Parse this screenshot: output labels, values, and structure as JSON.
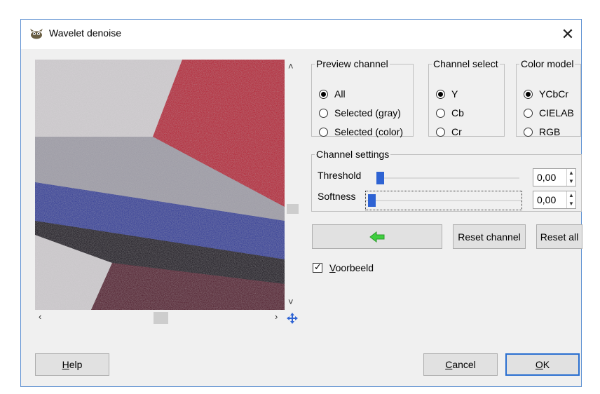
{
  "window": {
    "title": "Wavelet denoise",
    "close_label": "✕"
  },
  "preview_channel": {
    "legend": "Preview channel",
    "options": [
      {
        "label": "All",
        "selected": true
      },
      {
        "label": "Selected (gray)",
        "selected": false
      },
      {
        "label": "Selected (color)",
        "selected": false
      }
    ]
  },
  "channel_select": {
    "legend": "Channel select",
    "options": [
      {
        "label": "Y",
        "selected": true
      },
      {
        "label": "Cb",
        "selected": false
      },
      {
        "label": "Cr",
        "selected": false
      }
    ]
  },
  "color_model": {
    "legend": "Color model",
    "options": [
      {
        "label": "YCbCr",
        "selected": true
      },
      {
        "label": "CIELAB",
        "selected": false
      },
      {
        "label": "RGB",
        "selected": false
      }
    ]
  },
  "channel_settings": {
    "legend": "Channel settings",
    "threshold": {
      "label": "Threshold",
      "value": "0,00",
      "level": 0.0
    },
    "softness": {
      "label": "Softness",
      "value": "0,00",
      "level": 0.0
    }
  },
  "buttons": {
    "reset_channel": "Reset channel",
    "reset_all": "Reset all",
    "help_prefix": "H",
    "help_rest": "elp",
    "cancel_prefix": "C",
    "cancel_rest": "ancel",
    "ok_prefix": "O",
    "ok_rest": "K"
  },
  "preview_toggle": {
    "prefix": "V",
    "rest": "oorbeeld",
    "checked": true
  },
  "scroll": {
    "up": "˄",
    "down": "˅",
    "left": "‹",
    "right": "›"
  },
  "colors": {
    "accent": "#2e63d3",
    "arrow": "#3fcf3f",
    "default_border": "#2a6fd0"
  }
}
